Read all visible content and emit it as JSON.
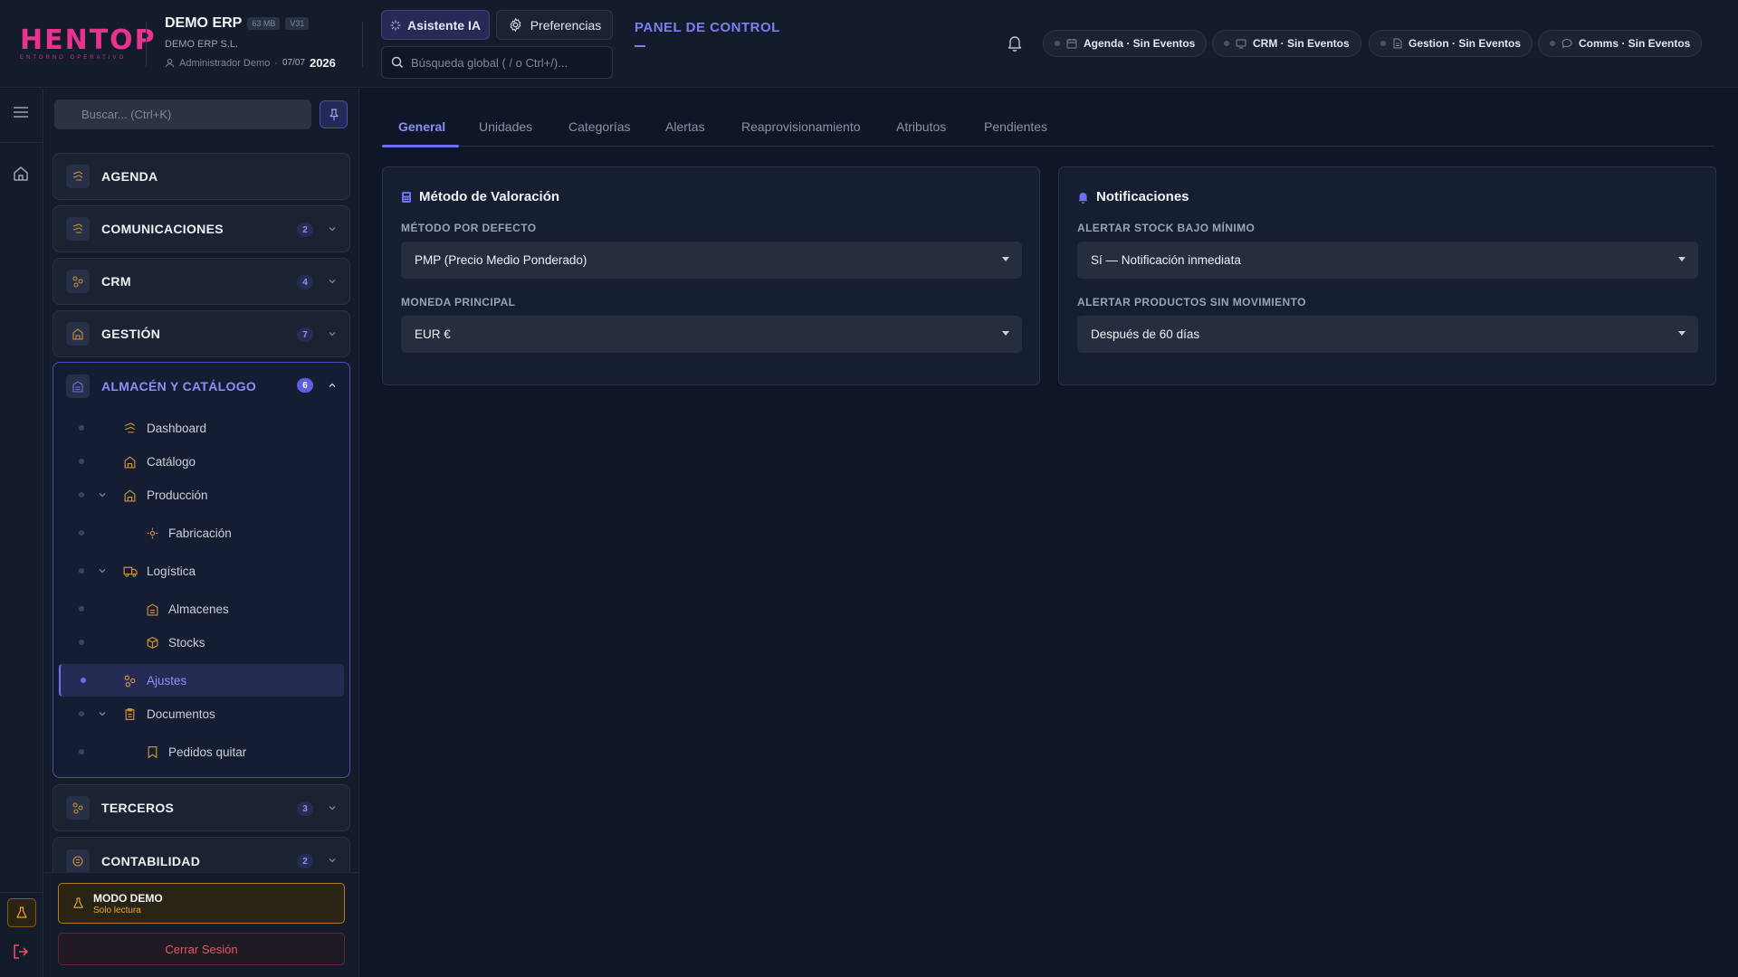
{
  "brand": {
    "logo_text": "HENTOP",
    "logo_sub": "ENTORNO OPERATIVO"
  },
  "company": {
    "name": "DEMO ERP",
    "size_badge": "63 MB",
    "version_badge": "V31",
    "legal_name": "DEMO ERP S.L.",
    "user": "Administrador Demo",
    "date": "07/07",
    "year": "2026"
  },
  "header": {
    "ai_button": "Asistente IA",
    "prefs_button": "Preferencias",
    "search_placeholder": "Búsqueda global ( / o Ctrl+/)...",
    "panel_title": "PANEL DE CONTROL",
    "panel_dash": "—",
    "events": [
      {
        "label": "Agenda · Sin Eventos",
        "icon": "calendar-icon"
      },
      {
        "label": "CRM · Sin Eventos",
        "icon": "monitor-icon"
      },
      {
        "label": "Gestion · Sin Eventos",
        "icon": "document-icon"
      },
      {
        "label": "Comms · Sin Eventos",
        "icon": "chat-icon"
      }
    ]
  },
  "sidebar": {
    "search_placeholder": "Buscar... (Ctrl+K)",
    "sections": [
      {
        "label": "AGENDA",
        "badge": ""
      },
      {
        "label": "COMUNICACIONES",
        "badge": "2"
      },
      {
        "label": "CRM",
        "badge": "4"
      },
      {
        "label": "GESTIÓN",
        "badge": "7"
      },
      {
        "label": "ALMACÉN Y CATÁLOGO",
        "badge": "6"
      },
      {
        "label": "TERCEROS",
        "badge": "3"
      },
      {
        "label": "CONTABILIDAD",
        "badge": "2"
      }
    ],
    "sub_items": [
      {
        "label": "Dashboard"
      },
      {
        "label": "Catálogo"
      },
      {
        "label": "Producción"
      },
      {
        "label": "Fabricación"
      },
      {
        "label": "Logística"
      },
      {
        "label": "Almacenes"
      },
      {
        "label": "Stocks"
      },
      {
        "label": "Ajustes"
      },
      {
        "label": "Documentos"
      },
      {
        "label": "Pedidos quitar"
      }
    ],
    "demo_title": "MODO DEMO",
    "demo_sub": "Solo lectura",
    "logout": "Cerrar Sesión"
  },
  "tabs": [
    "General",
    "Unidades",
    "Categorías",
    "Alertas",
    "Reaprovisionamiento",
    "Atributos",
    "Pendientes"
  ],
  "valuation_card": {
    "title": "Método de Valoración",
    "method_label": "MÉTODO POR DEFECTO",
    "method_value": "PMP (Precio Medio Ponderado)",
    "currency_label": "MONEDA PRINCIPAL",
    "currency_value": "EUR €"
  },
  "notifications_card": {
    "title": "Notificaciones",
    "low_stock_label": "ALERTAR STOCK BAJO MÍNIMO",
    "low_stock_value": "Sí — Notificación inmediata",
    "no_movement_label": "ALERTAR PRODUCTOS SIN MOVIMIENTO",
    "no_movement_value": "Después de 60 días"
  },
  "colors": {
    "accent": "#6d71f0",
    "brand": "#e8338f",
    "warning": "#b7791f",
    "danger": "#f0515f",
    "background": "#0e1628"
  }
}
